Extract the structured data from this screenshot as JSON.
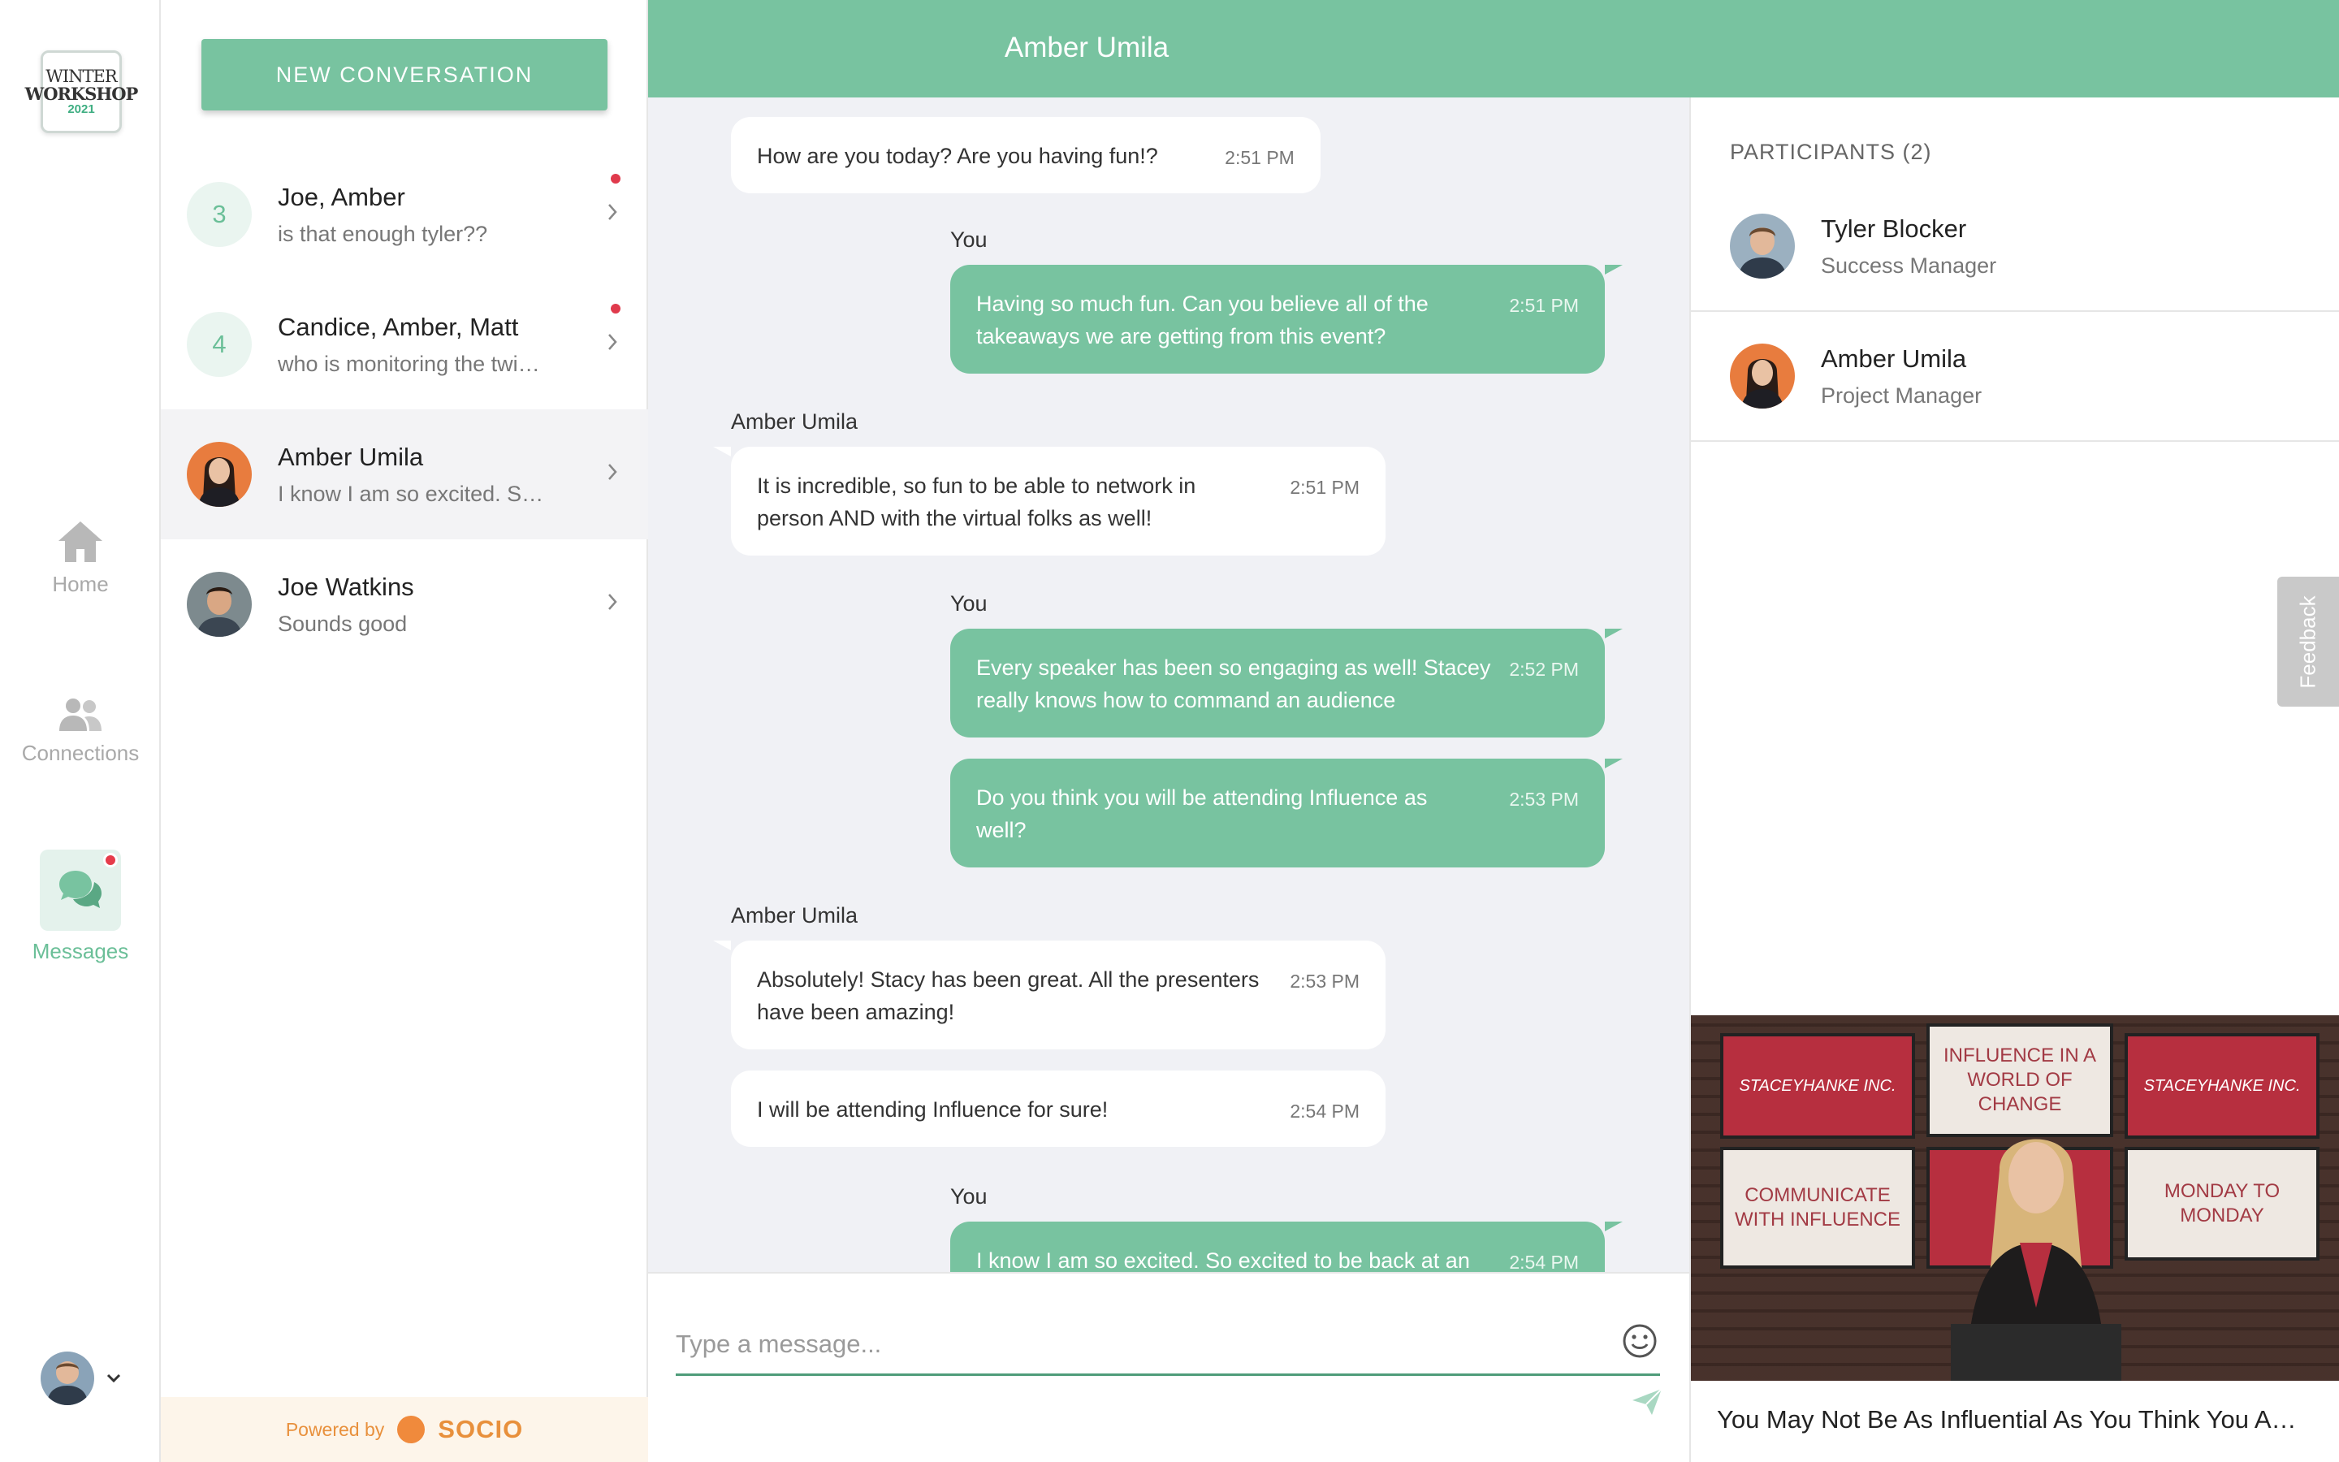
{
  "logo": {
    "line1": "WINTER",
    "line2": "WORKSHOP",
    "line3": "2021"
  },
  "nav": {
    "home": "Home",
    "connections": "Connections",
    "messages": "Messages"
  },
  "conversations": {
    "new_button": "NEW CONVERSATION",
    "items": [
      {
        "count": "3",
        "name": "Joe, Amber",
        "preview": "is that enough tyler??",
        "unread": true
      },
      {
        "count": "4",
        "name": "Candice, Amber, Matt",
        "preview": "who is monitoring the twi…",
        "unread": true
      },
      {
        "name": "Amber Umila",
        "preview": "I know I am so excited. S…",
        "active": true
      },
      {
        "name": "Joe Watkins",
        "preview": "Sounds good"
      }
    ],
    "powered_by": "Powered by",
    "brand": "SOCIO"
  },
  "chat": {
    "title": "Amber Umila",
    "you_label": "You",
    "other_label": "Amber Umila",
    "messages": [
      {
        "from": "other",
        "text": "How are you today? Are you having fun!?",
        "time": "2:51 PM"
      },
      {
        "from": "you",
        "text": "Having so much fun. Can you believe all of the takeaways we are getting from this event?",
        "time": "2:51 PM"
      },
      {
        "from": "other",
        "text": "It is incredible, so fun to be able to network in person AND with the virtual folks as well!",
        "time": "2:51 PM"
      },
      {
        "from": "you",
        "text": "Every speaker has been so engaging as well! Stacey really knows how to command an audience",
        "time": "2:52 PM"
      },
      {
        "from": "you",
        "text": "Do you think you will be attending Influence as well?",
        "time": "2:53 PM"
      },
      {
        "from": "other",
        "text": "Absolutely! Stacy has been great. All the presenters have been amazing!",
        "time": "2:53 PM"
      },
      {
        "from": "other",
        "text": "I will be attending Influence for sure!",
        "time": "2:54 PM"
      },
      {
        "from": "you",
        "text": "I know I am so excited. So excited to be back at an",
        "time": "2:54 PM"
      }
    ],
    "composer_placeholder": "Type a message..."
  },
  "participants": {
    "title": "PARTICIPANTS (2)",
    "items": [
      {
        "name": "Tyler Blocker",
        "role": "Success Manager"
      },
      {
        "name": "Amber Umila",
        "role": "Project Manager"
      }
    ],
    "feedback": "Feedback"
  },
  "video": {
    "screens": {
      "top_left": "STACEYHANKE INC.",
      "top_middle": "INFLUENCE IN A WORLD OF CHANGE",
      "top_right": "STACEYHANKE INC.",
      "bottom_left": "COMMUNICATE WITH INFLUENCE",
      "bottom_right": "MONDAY TO MONDAY"
    },
    "caption": "You May Not Be As Influential As You Think You A…"
  },
  "colors": {
    "accent": "#78c3a0",
    "accent_light": "#e4f2ec",
    "unread": "#e03a4c",
    "brand_orange": "#e8903c"
  }
}
